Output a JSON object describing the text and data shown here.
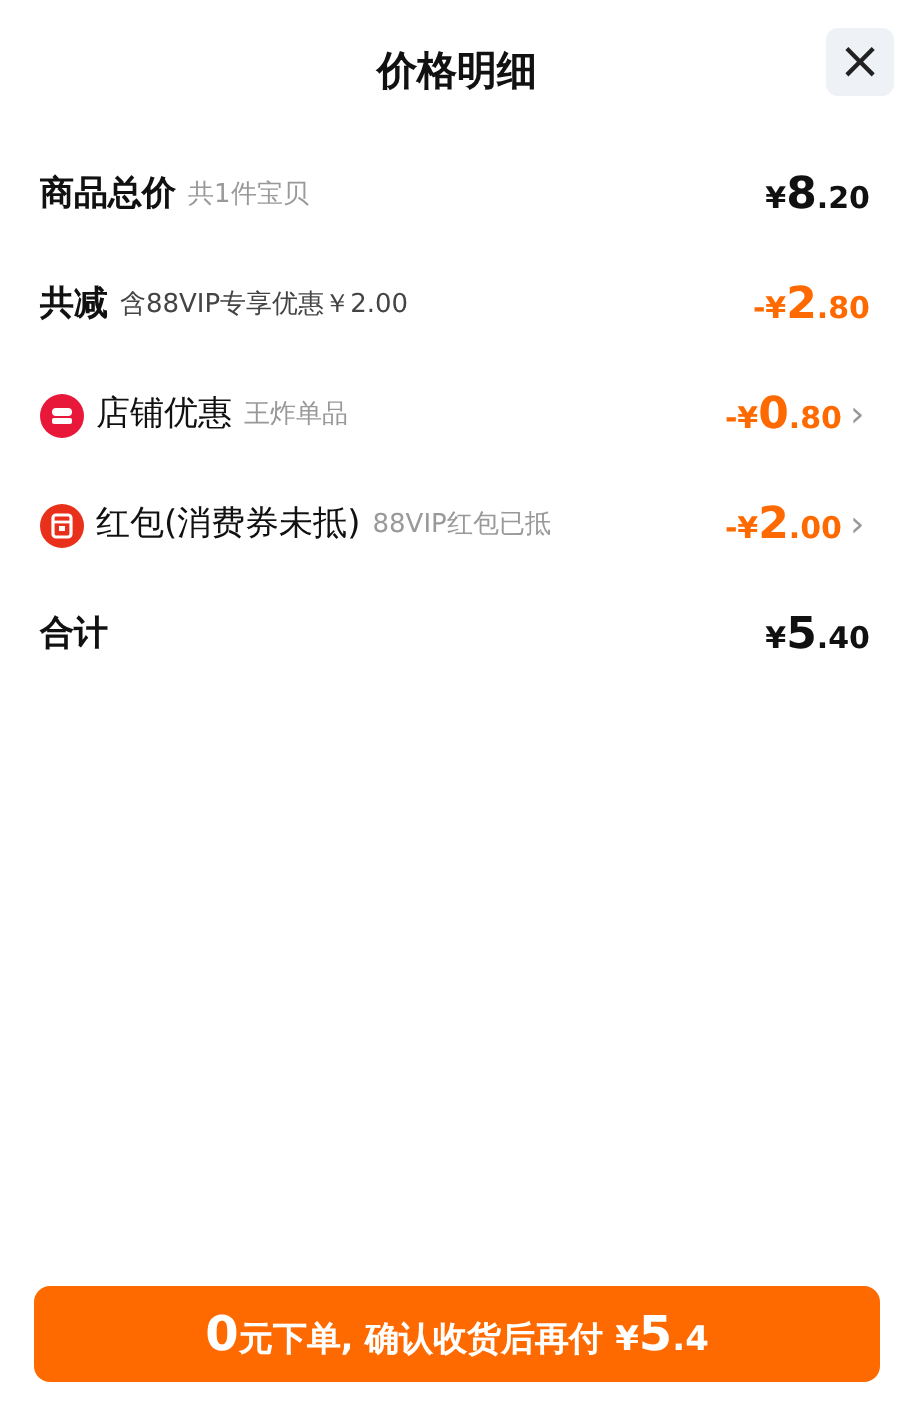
{
  "header": {
    "title": "价格明细",
    "close": "×"
  },
  "rows": [
    {
      "kind": "total",
      "label": "商品总价",
      "note": "共1件宝贝",
      "amount": {
        "sign": "¥",
        "whole": "8",
        "fraction": ".20"
      }
    },
    {
      "kind": "saving",
      "label": "共减",
      "note": "含88VIP专享优惠￥2.00",
      "amount": {
        "sign": "-¥",
        "whole": "2",
        "fraction": ".80"
      }
    },
    {
      "kind": "shop_discount",
      "label": "店铺优惠",
      "note": "王炸单品",
      "amount": {
        "sign": "-¥",
        "whole": "0",
        "fraction": ".80"
      },
      "chevron": "›"
    },
    {
      "kind": "red_packet",
      "label": "红包(消费券未抵)",
      "note": "88VIP红包已抵",
      "amount": {
        "sign": "-¥",
        "whole": "2",
        "fraction": ".00"
      },
      "chevron": "›"
    },
    {
      "kind": "total",
      "label": "合计",
      "amount": {
        "sign": "¥",
        "whole": "5",
        "fraction": ".40"
      }
    }
  ],
  "submit": {
    "segments": [
      {
        "text": "0",
        "big": true
      },
      {
        "text": "元下单, 确认收货后再付 ¥",
        "big": false
      },
      {
        "text": "5",
        "big": true
      },
      {
        "text": ".4",
        "big": false
      }
    ]
  }
}
